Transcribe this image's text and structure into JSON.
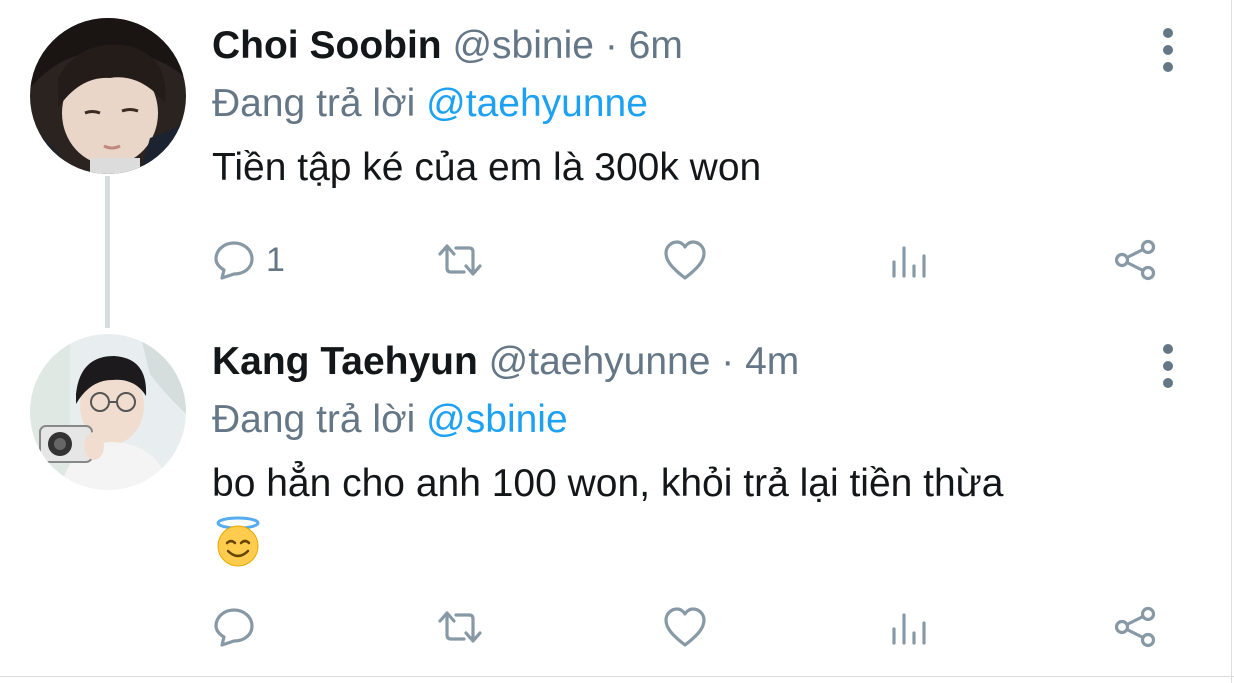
{
  "tweets": [
    {
      "name": "Choi Soobin",
      "handle": "@sbinie",
      "separator": "·",
      "time": "6m",
      "reply_prefix": "Đang trả lời",
      "reply_to": "@taehyunne",
      "text": "Tiền tập ké của em là 300k won",
      "reply_count": "1",
      "icons": [
        "reply-icon",
        "retweet-icon",
        "like-icon",
        "analytics-icon",
        "share-icon",
        "more-icon"
      ]
    },
    {
      "name": "Kang Taehyun",
      "handle": "@taehyunne",
      "separator": "·",
      "time": "4m",
      "reply_prefix": "Đang trả lời",
      "reply_to": "@sbinie",
      "text": "bo hẳn cho anh 100 won, khỏi trả lại tiền thừa",
      "emoji": "smiling-face-with-halo",
      "icons": [
        "reply-icon",
        "retweet-icon",
        "like-icon",
        "analytics-icon",
        "share-icon",
        "more-icon"
      ]
    }
  ],
  "colors": {
    "text_primary": "#14171a",
    "text_secondary": "#657786",
    "mention_blue": "#1da1f2",
    "icon_gray": "#8899a6",
    "thread_line": "#d6dce0"
  }
}
